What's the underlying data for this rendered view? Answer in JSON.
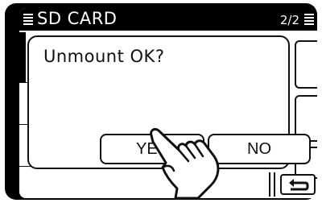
{
  "titlebar": {
    "title": "SD CARD",
    "page": "2/2"
  },
  "dialog": {
    "message": "Unmount OK?",
    "yes_label": "YES",
    "no_label": "NO"
  },
  "icons": {
    "menu": "menu-lines-icon",
    "scroll": "scroll-lines-icon",
    "back": "return-arrow-icon",
    "hand": "pointing-hand-icon"
  },
  "colors": {
    "bar": "#000000",
    "background": "#ffffff",
    "outline": "#111111"
  }
}
